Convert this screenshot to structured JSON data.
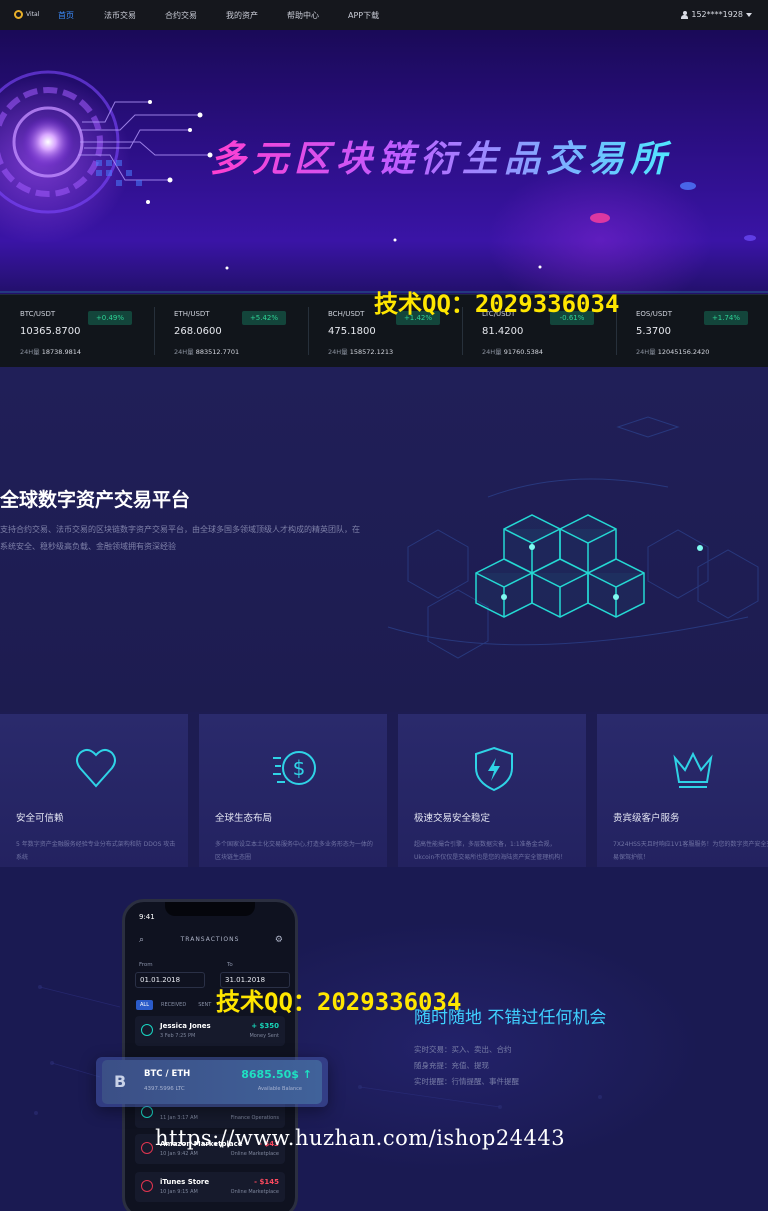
{
  "nav": {
    "logo_text": "Vital",
    "items": [
      {
        "label": "首页",
        "active": true
      },
      {
        "label": "法币交易",
        "active": false
      },
      {
        "label": "合约交易",
        "active": false
      },
      {
        "label": "我的资产",
        "active": false
      },
      {
        "label": "帮助中心",
        "active": false
      },
      {
        "label": "APP下载",
        "active": false
      }
    ],
    "user": "152****1928"
  },
  "hero": {
    "title": "多元区块链衍生品交易所"
  },
  "watermarks": {
    "qq_text": "技术QQ：2029336034",
    "url_text": "https://www.huzhan.com/ishop24443"
  },
  "ticker": [
    {
      "pair": "BTC/USDT",
      "price": "10365.8700",
      "change": "+0.49%",
      "vol_label": "24H量",
      "vol": "18738.9814"
    },
    {
      "pair": "ETH/USDT",
      "price": "268.0600",
      "change": "+5.42%",
      "vol_label": "24H量",
      "vol": "883512.7701"
    },
    {
      "pair": "BCH/USDT",
      "price": "475.1800",
      "change": "+1.42%",
      "vol_label": "24H量",
      "vol": "158572.1213"
    },
    {
      "pair": "LTC/USDT",
      "price": "81.4200",
      "change": "-0.61%",
      "vol_label": "24H量",
      "vol": "91760.5384"
    },
    {
      "pair": "EOS/USDT",
      "price": "5.3700",
      "change": "+1.74%",
      "vol_label": "24H量",
      "vol": "12045156.2420"
    }
  ],
  "platform": {
    "title": "全球数字资产交易平台",
    "desc": "支持合约交易、法币交易的区块链数字资产交易平台，由全球多国多领域顶级人才构成的精英团队，在系统安全、稳秒级高负载、金融领域拥有资深经验"
  },
  "features": [
    {
      "title": "安全可信赖",
      "icon": "heart-icon",
      "desc": "5 年数字资产金融服务经验专业分布式架构和防 DDOS 攻击系统"
    },
    {
      "title": "全球生态布局",
      "icon": "dollar-coin-icon",
      "desc": "多个国家设立本土化交易服务中心,打造多业务形态为一体的区块链生态圈"
    },
    {
      "title": "极速交易安全稳定",
      "icon": "shield-bolt-icon",
      "desc": "超高性能撮合引擎，多层数据灾备，1:1准备金合规，Ukcoin不仅仅是交易所也是您的海陆资产安全管理机构！"
    },
    {
      "title": "贵宾级客户服务",
      "icon": "crown-icon",
      "desc": "7X24HSS天且时响应1V1客服服务！为您的数字资产安全交易保驾护航！"
    }
  ],
  "app": {
    "title": "随时随地 不错过任何机会",
    "lines": [
      "实时交易：买入、卖出、合约",
      "随身充提：充值、提现",
      "实时提醒：行情提醒、事件提醒"
    ]
  },
  "phone": {
    "time": "9:41",
    "header": "TRANSACTIONS",
    "from_label": "From",
    "to_label": "To",
    "from_date": "01.01.2018",
    "to_date": "31.01.2018",
    "tabs": [
      "ALL",
      "RECEIVED",
      "SENT"
    ],
    "transactions": [
      {
        "name": "Jessica Jones",
        "date": "3 Feb 7:25 PM",
        "amount": "+ $350",
        "type": "Money Sent",
        "negative": false
      },
      {
        "name": "",
        "date": "11 Jan 3:17 AM",
        "amount": "",
        "type": "Finance Operations",
        "negative": false
      },
      {
        "name": "Amazon Marketplace",
        "date": "10 Jan 9:42 AM",
        "amount": "- $43",
        "type": "Online Marketplace",
        "negative": true
      },
      {
        "name": "iTunes Store",
        "date": "10 Jan 9:15 AM",
        "amount": "- $145",
        "type": "Online Marketplace",
        "negative": true
      }
    ],
    "float_card": {
      "symbol": "B",
      "pair": "BTC / ETH",
      "sub": "4397.5996 LTC",
      "price": "8685.50$ ↑",
      "label": "Available Balance"
    }
  },
  "colors": {
    "accent_blue": "#3c8cff",
    "up_green": "#2ed295",
    "teal": "#1fe0c2",
    "watermark_yellow": "#ffe600"
  }
}
